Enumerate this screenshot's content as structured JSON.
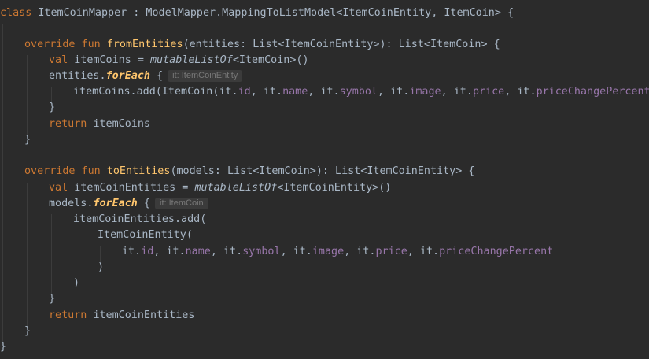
{
  "editor": {
    "lines": [
      [
        [
          "kw",
          "class "
        ],
        [
          "",
          "ItemCoinMapper : ModelMapper.MappingToListModel<ItemCoinEntity, ItemCoin> {"
        ]
      ],
      [],
      [
        [
          "kw",
          "override fun "
        ],
        [
          "fn",
          "fromEntities"
        ],
        [
          "",
          "(entities: List<ItemCoinEntity>): List<ItemCoin> {"
        ]
      ],
      [
        [
          "kw",
          "val "
        ],
        [
          "",
          "itemCoins = "
        ],
        [
          "mut",
          "mutableListOf"
        ],
        [
          "",
          "<ItemCoin>()"
        ]
      ],
      [
        [
          "",
          "entities."
        ],
        [
          "it",
          "forEach"
        ],
        [
          "",
          " {"
        ],
        [
          "hint",
          "it: ItemCoinEntity"
        ]
      ],
      [
        [
          "",
          "itemCoins.add(ItemCoin("
        ],
        [
          "",
          "it."
        ],
        [
          "prop",
          "id"
        ],
        [
          "",
          ", it."
        ],
        [
          "prop",
          "name"
        ],
        [
          "",
          ", it."
        ],
        [
          "prop",
          "symbol"
        ],
        [
          "",
          ", it."
        ],
        [
          "prop",
          "image"
        ],
        [
          "",
          ", it."
        ],
        [
          "prop",
          "price"
        ],
        [
          "",
          ", it."
        ],
        [
          "prop",
          "priceChangePercent"
        ],
        [
          "",
          "))"
        ]
      ],
      [
        [
          "",
          "}"
        ]
      ],
      [
        [
          "kw",
          "return "
        ],
        [
          "",
          "itemCoins"
        ]
      ],
      [
        [
          "",
          "}"
        ]
      ],
      [],
      [
        [
          "kw",
          "override fun "
        ],
        [
          "fn",
          "toEntities"
        ],
        [
          "",
          "(models: List<ItemCoin>): List<ItemCoinEntity> {"
        ]
      ],
      [
        [
          "kw",
          "val "
        ],
        [
          "",
          "itemCoinEntities = "
        ],
        [
          "mut",
          "mutableListOf"
        ],
        [
          "",
          "<ItemCoinEntity>()"
        ]
      ],
      [
        [
          "",
          "models."
        ],
        [
          "it",
          "forEach"
        ],
        [
          "",
          " {"
        ],
        [
          "hint",
          "it: ItemCoin"
        ]
      ],
      [
        [
          "",
          "itemCoinEntities.add("
        ]
      ],
      [
        [
          "",
          "ItemCoinEntity("
        ]
      ],
      [
        [
          "",
          "it."
        ],
        [
          "prop",
          "id"
        ],
        [
          "",
          ", it."
        ],
        [
          "prop",
          "name"
        ],
        [
          "",
          ", it."
        ],
        [
          "prop",
          "symbol"
        ],
        [
          "",
          ", it."
        ],
        [
          "prop",
          "image"
        ],
        [
          "",
          ", it."
        ],
        [
          "prop",
          "price"
        ],
        [
          "",
          ", it."
        ],
        [
          "prop",
          "priceChangePercent"
        ]
      ],
      [
        [
          "",
          ")"
        ]
      ],
      [
        [
          "",
          ")"
        ]
      ],
      [
        [
          "",
          "}"
        ]
      ],
      [
        [
          "kw",
          "return "
        ],
        [
          "",
          "itemCoinEntities"
        ]
      ],
      [
        [
          "",
          "}"
        ]
      ],
      [
        [
          "",
          "}"
        ]
      ]
    ]
  }
}
